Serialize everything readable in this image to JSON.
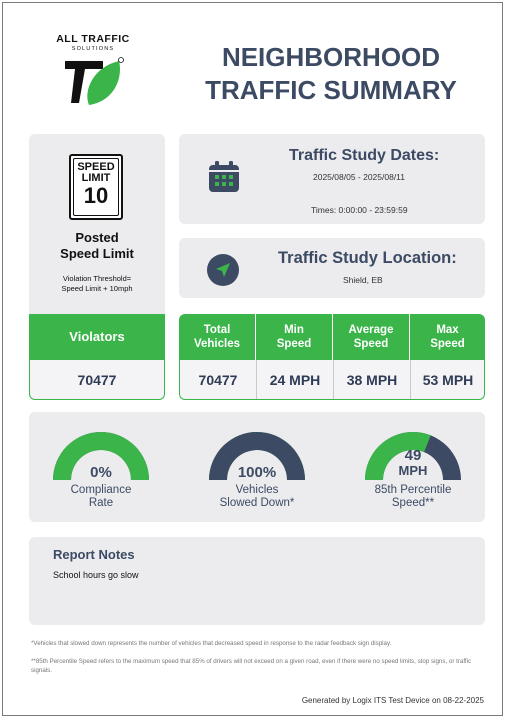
{
  "logo": {
    "brand_line": "ALL TRAFFIC",
    "sub_line": "SOLUTIONS"
  },
  "title": {
    "line1": "NEIGHBORHOOD",
    "line2": "TRAFFIC SUMMARY"
  },
  "speed_sign": {
    "line1": "SPEED",
    "line2": "LIMIT",
    "value": "10"
  },
  "posted": {
    "line1": "Posted",
    "line2": "Speed Limit"
  },
  "threshold": {
    "line1": "Violation Threshold=",
    "line2": "Speed Limit + 10mph"
  },
  "violators": {
    "label": "Violators",
    "value": "70477"
  },
  "study_dates": {
    "heading": "Traffic Study Dates:",
    "range": "2025/08/05 - 2025/08/11",
    "times": "Times: 0:00:00 - 23:59:59"
  },
  "study_location": {
    "heading": "Traffic Study Location:",
    "value": "Shield, EB"
  },
  "stats": [
    {
      "label1": "Total",
      "label2": "Vehicles",
      "value": "70477"
    },
    {
      "label1": "Min",
      "label2": "Speed",
      "value": "24 MPH"
    },
    {
      "label1": "Average",
      "label2": "Speed",
      "value": "38 MPH"
    },
    {
      "label1": "Max",
      "label2": "Speed",
      "value": "53 MPH"
    }
  ],
  "gauges": [
    {
      "value_text": "0%",
      "label1": "Compliance",
      "label2": "Rate",
      "fill_fraction": 1.0,
      "fill_color": "#3bb54a",
      "track_color": "#3c4a63"
    },
    {
      "value_text": "100%",
      "label1": "Vehicles",
      "label2": "Slowed Down*",
      "fill_fraction": 1.0,
      "fill_color": "#3c4a63",
      "track_color": "#3bb54a"
    },
    {
      "value_text": "49",
      "value_unit": "MPH",
      "label1": "85th Percentile",
      "label2": "Speed**",
      "fill_fraction": 0.62,
      "fill_color": "#3bb54a",
      "track_color": "#3c4a63"
    }
  ],
  "notes": {
    "title": "Report Notes",
    "body": "School hours go slow"
  },
  "footnotes": {
    "f1": "*Vehicles that slowed down represents the number of vehicles that decreased speed in response to the radar feedback sign display.",
    "f2": "**85th Percentile Speed refers to the maximum speed that 85% of drivers will not exceed on a given road, even if there were no speed limits, stop signs, or traffic signals."
  },
  "generated": "Generated by Logix ITS Test Device on 08-22-2025",
  "colors": {
    "green": "#3bb54a",
    "navy": "#3c4a63",
    "card": "#ececef"
  },
  "icons": {
    "calendar": "calendar-icon",
    "location": "navigation-arrow-icon"
  }
}
